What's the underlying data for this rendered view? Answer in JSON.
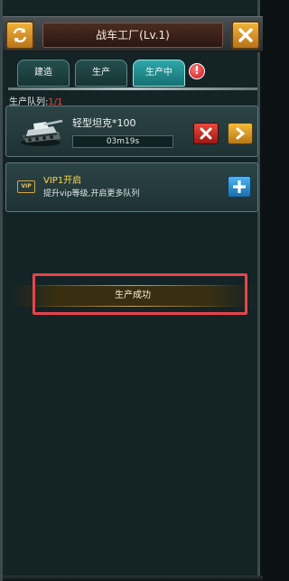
{
  "header": {
    "title": "战车工厂(Lv.1)",
    "left_button_icon": "refresh-arrows-icon",
    "close_button_icon": "close-x-icon"
  },
  "tabs": [
    {
      "label": "建造",
      "active": false
    },
    {
      "label": "生产",
      "active": false
    },
    {
      "label": "生产中",
      "active": true
    }
  ],
  "alert_badge": "!",
  "queue": {
    "label": "生产队列:",
    "count": "1/1"
  },
  "production_item": {
    "name": "轻型坦克*100",
    "timer": "03m19s",
    "icon": "light-tank-icon"
  },
  "vip_slot": {
    "badge": "VIP",
    "title": "VIP1开启",
    "description": "提升vip等级,开启更多队列"
  },
  "toast": {
    "message": "生产成功"
  },
  "colors": {
    "accent_gold": "#f2b43a",
    "active_tab": "#2fa7a8",
    "cancel_red": "#ec4a3c",
    "plus_blue": "#4db6f2",
    "queue_count_red": "#f04a3e",
    "highlight_outline": "#e8444c"
  }
}
